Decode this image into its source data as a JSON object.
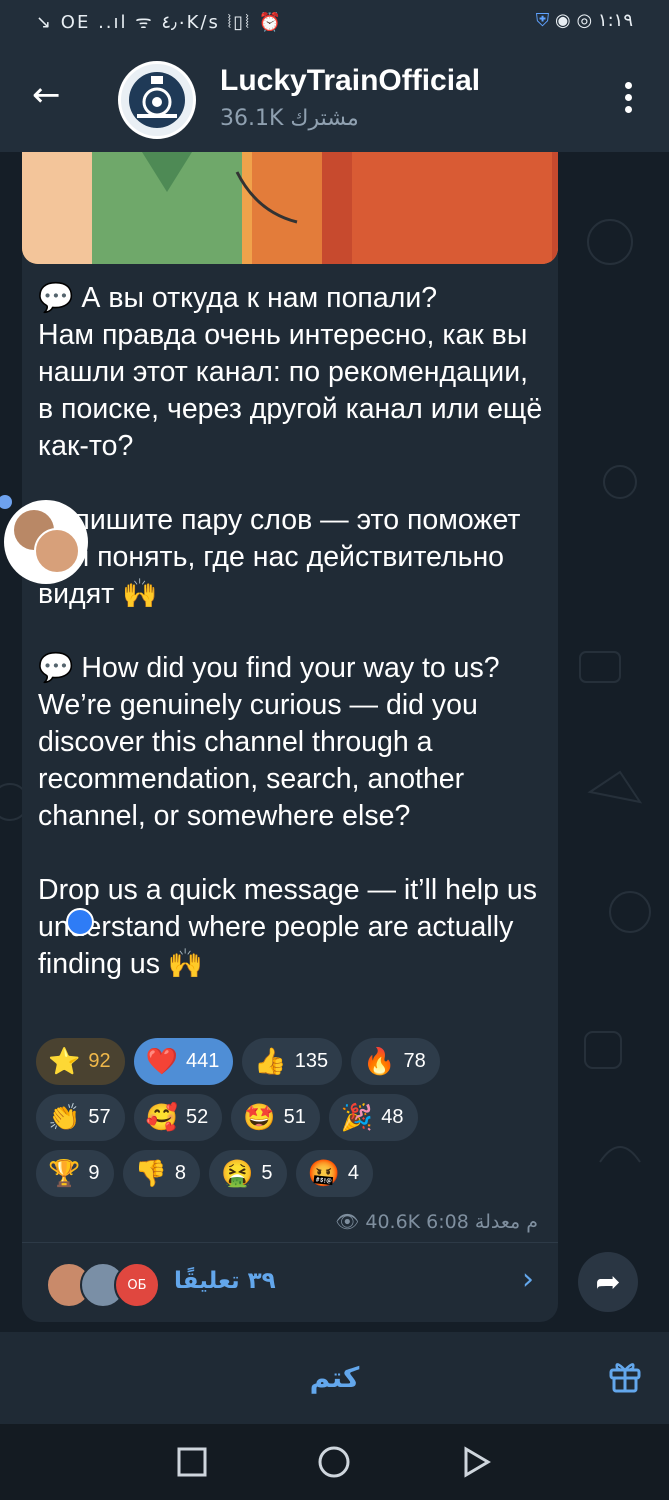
{
  "status_bar": {
    "left": "↘︎ OE ..ıl ᯤ ٤٫٠K/s ⦚▯⦚ ⏰",
    "time": "١:١٩"
  },
  "header": {
    "back_icon": "arrow-left-icon",
    "title": "LuckyTrainOfficial",
    "subtitle": "36.1K مشترك",
    "menu_icon": "more-vert-icon"
  },
  "post": {
    "text": "💬 А вы откуда к нам попали?\nНам правда очень интересно, как вы нашли этот канал: по рекомендации, в поиске, через другой канал или ещё как-то?\n\nНапишите пару слов — это поможет нам понять, где нас действительно видят 🙌\n\n💬 How did you find your way to us?\nWe’re genuinely curious — did you discover this channel through a recommendation, search, another channel, or somewhere else?\n\nDrop us a quick message — it’ll help us understand where people are actually finding us 🙌",
    "reactions_rows": [
      [
        {
          "emoji": "⭐",
          "count": "92",
          "style": "gold"
        },
        {
          "emoji": "❤️",
          "count": "441",
          "style": "sel"
        },
        {
          "emoji": "👍",
          "count": "135",
          "style": ""
        },
        {
          "emoji": "🔥",
          "count": "78",
          "style": ""
        }
      ],
      [
        {
          "emoji": "👏",
          "count": "57",
          "style": ""
        },
        {
          "emoji": "🥰",
          "count": "52",
          "style": ""
        },
        {
          "emoji": "🤩",
          "count": "51",
          "style": ""
        },
        {
          "emoji": "🎉",
          "count": "48",
          "style": ""
        }
      ],
      [
        {
          "emoji": "🏆",
          "count": "9",
          "style": ""
        },
        {
          "emoji": "👎",
          "count": "8",
          "style": ""
        },
        {
          "emoji": "🤮",
          "count": "5",
          "style": ""
        },
        {
          "emoji": "🤬",
          "count": "4",
          "style": ""
        }
      ]
    ],
    "meta": "40.6K  6:08 م  معدلة",
    "comments_label": "٣٩ تعليقًا",
    "comment_avatar_initials": "ОБ"
  },
  "bottom": {
    "mute_label": "كتم"
  },
  "colors": {
    "accent": "#63a7ec",
    "bubble": "#202b36",
    "header": "#222e3a"
  }
}
